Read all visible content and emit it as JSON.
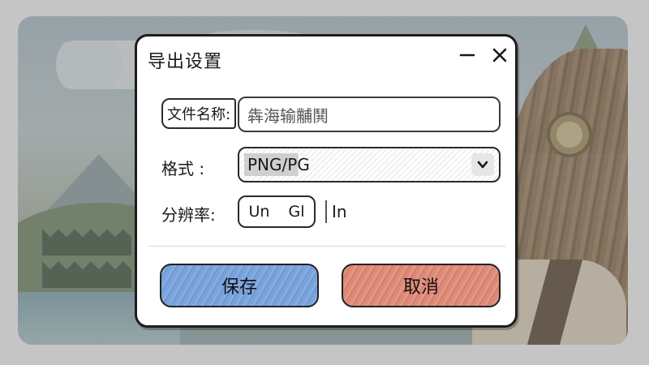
{
  "dialog": {
    "title": "导出设置",
    "filename": {
      "label": "文件名称:",
      "value": "犇海输黼鬨"
    },
    "format": {
      "label": "格式  :",
      "selected": "PNG/PG"
    },
    "resolution": {
      "label": "分辨率:",
      "field_a": "Un",
      "field_b": "Gl",
      "unit": "In"
    },
    "buttons": {
      "save": "保存",
      "cancel": "取消"
    }
  },
  "colors": {
    "save_button": "#7aa3dd",
    "cancel_button": "#dd8a78",
    "dialog_border": "#1d1d1d"
  },
  "icons": {
    "minimize": "minimize-icon",
    "close": "close-icon",
    "dropdown": "chevron-down-icon"
  }
}
